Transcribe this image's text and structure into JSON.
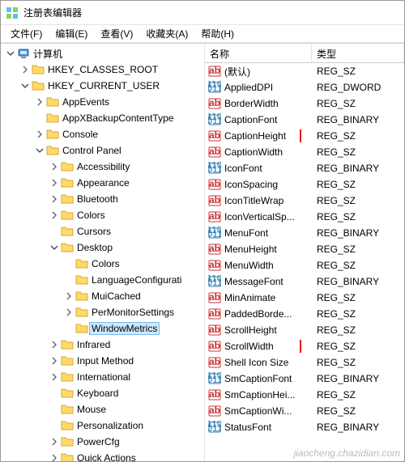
{
  "window": {
    "title": "注册表编辑器"
  },
  "menubar": [
    {
      "label": "文件(F)"
    },
    {
      "label": "编辑(E)"
    },
    {
      "label": "查看(V)"
    },
    {
      "label": "收藏夹(A)"
    },
    {
      "label": "帮助(H)"
    }
  ],
  "tree": [
    {
      "depth": 0,
      "exp": "open",
      "icon": "computer",
      "label": "计算机",
      "sel": false
    },
    {
      "depth": 1,
      "exp": "closed",
      "icon": "folder",
      "label": "HKEY_CLASSES_ROOT",
      "sel": false
    },
    {
      "depth": 1,
      "exp": "open",
      "icon": "folder",
      "label": "HKEY_CURRENT_USER",
      "sel": false
    },
    {
      "depth": 2,
      "exp": "closed",
      "icon": "folder",
      "label": "AppEvents",
      "sel": false
    },
    {
      "depth": 2,
      "exp": "none",
      "icon": "folder",
      "label": "AppXBackupContentType",
      "sel": false
    },
    {
      "depth": 2,
      "exp": "closed",
      "icon": "folder",
      "label": "Console",
      "sel": false
    },
    {
      "depth": 2,
      "exp": "open",
      "icon": "folder",
      "label": "Control Panel",
      "sel": false
    },
    {
      "depth": 3,
      "exp": "closed",
      "icon": "folder",
      "label": "Accessibility",
      "sel": false
    },
    {
      "depth": 3,
      "exp": "closed",
      "icon": "folder",
      "label": "Appearance",
      "sel": false
    },
    {
      "depth": 3,
      "exp": "closed",
      "icon": "folder",
      "label": "Bluetooth",
      "sel": false
    },
    {
      "depth": 3,
      "exp": "closed",
      "icon": "folder",
      "label": "Colors",
      "sel": false
    },
    {
      "depth": 3,
      "exp": "none",
      "icon": "folder",
      "label": "Cursors",
      "sel": false
    },
    {
      "depth": 3,
      "exp": "open",
      "icon": "folder",
      "label": "Desktop",
      "sel": false
    },
    {
      "depth": 4,
      "exp": "none",
      "icon": "folder",
      "label": "Colors",
      "sel": false
    },
    {
      "depth": 4,
      "exp": "none",
      "icon": "folder",
      "label": "LanguageConfigurati",
      "sel": false
    },
    {
      "depth": 4,
      "exp": "closed",
      "icon": "folder",
      "label": "MuiCached",
      "sel": false
    },
    {
      "depth": 4,
      "exp": "closed",
      "icon": "folder",
      "label": "PerMonitorSettings",
      "sel": false
    },
    {
      "depth": 4,
      "exp": "none",
      "icon": "folder",
      "label": "WindowMetrics",
      "sel": true
    },
    {
      "depth": 3,
      "exp": "closed",
      "icon": "folder",
      "label": "Infrared",
      "sel": false
    },
    {
      "depth": 3,
      "exp": "closed",
      "icon": "folder",
      "label": "Input Method",
      "sel": false
    },
    {
      "depth": 3,
      "exp": "closed",
      "icon": "folder",
      "label": "International",
      "sel": false
    },
    {
      "depth": 3,
      "exp": "none",
      "icon": "folder",
      "label": "Keyboard",
      "sel": false
    },
    {
      "depth": 3,
      "exp": "none",
      "icon": "folder",
      "label": "Mouse",
      "sel": false
    },
    {
      "depth": 3,
      "exp": "none",
      "icon": "folder",
      "label": "Personalization",
      "sel": false
    },
    {
      "depth": 3,
      "exp": "closed",
      "icon": "folder",
      "label": "PowerCfg",
      "sel": false
    },
    {
      "depth": 3,
      "exp": "closed",
      "icon": "folder",
      "label": "Quick Actions",
      "sel": false
    }
  ],
  "list": {
    "headers": {
      "name": "名称",
      "type": "类型"
    },
    "rows": [
      {
        "icon": "sz",
        "name": "(默认)",
        "type": "REG_SZ",
        "hl": false
      },
      {
        "icon": "bin",
        "name": "AppliedDPI",
        "type": "REG_DWORD",
        "hl": false
      },
      {
        "icon": "sz",
        "name": "BorderWidth",
        "type": "REG_SZ",
        "hl": false
      },
      {
        "icon": "bin",
        "name": "CaptionFont",
        "type": "REG_BINARY",
        "hl": false
      },
      {
        "icon": "sz",
        "name": "CaptionHeight",
        "type": "REG_SZ",
        "hl": true
      },
      {
        "icon": "sz",
        "name": "CaptionWidth",
        "type": "REG_SZ",
        "hl": false
      },
      {
        "icon": "bin",
        "name": "IconFont",
        "type": "REG_BINARY",
        "hl": false
      },
      {
        "icon": "sz",
        "name": "IconSpacing",
        "type": "REG_SZ",
        "hl": false
      },
      {
        "icon": "sz",
        "name": "IconTitleWrap",
        "type": "REG_SZ",
        "hl": false
      },
      {
        "icon": "sz",
        "name": "IconVerticalSp...",
        "type": "REG_SZ",
        "hl": false
      },
      {
        "icon": "bin",
        "name": "MenuFont",
        "type": "REG_BINARY",
        "hl": false
      },
      {
        "icon": "sz",
        "name": "MenuHeight",
        "type": "REG_SZ",
        "hl": false
      },
      {
        "icon": "sz",
        "name": "MenuWidth",
        "type": "REG_SZ",
        "hl": false
      },
      {
        "icon": "bin",
        "name": "MessageFont",
        "type": "REG_BINARY",
        "hl": false
      },
      {
        "icon": "sz",
        "name": "MinAnimate",
        "type": "REG_SZ",
        "hl": false
      },
      {
        "icon": "sz",
        "name": "PaddedBorde...",
        "type": "REG_SZ",
        "hl": false
      },
      {
        "icon": "sz",
        "name": "ScrollHeight",
        "type": "REG_SZ",
        "hl": false
      },
      {
        "icon": "sz",
        "name": "ScrollWidth",
        "type": "REG_SZ",
        "hl": true
      },
      {
        "icon": "sz",
        "name": "Shell Icon Size",
        "type": "REG_SZ",
        "hl": false
      },
      {
        "icon": "bin",
        "name": "SmCaptionFont",
        "type": "REG_BINARY",
        "hl": false
      },
      {
        "icon": "sz",
        "name": "SmCaptionHei...",
        "type": "REG_SZ",
        "hl": false
      },
      {
        "icon": "sz",
        "name": "SmCaptionWi...",
        "type": "REG_SZ",
        "hl": false
      },
      {
        "icon": "bin",
        "name": "StatusFont",
        "type": "REG_BINARY",
        "hl": false
      }
    ]
  },
  "watermark": "jiaocheng.chazidian.com"
}
